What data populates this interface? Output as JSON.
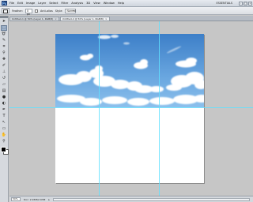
{
  "app": {
    "logo": "Ps",
    "menu": [
      "File",
      "Edit",
      "Image",
      "Layer",
      "Select",
      "Filter",
      "Analysis",
      "3D",
      "View",
      "Window",
      "Help"
    ],
    "workspace": "ESSENTIALS"
  },
  "options": {
    "feather_label": "Feather:",
    "feather_value": "0 px",
    "antialias_label": "Anti-alias",
    "style_label": "Style:",
    "style_value": "Normal"
  },
  "tabs": [
    {
      "label": "Untitled-1 @ 50% (Layer 1, RGB/8)"
    },
    {
      "label": "Untitled-2 @ 50% (Layer 1, RGB/8)"
    }
  ],
  "status": {
    "zoom": "50%",
    "doc_info": "Doc: 2.93M/2.93M"
  },
  "tools": [
    "move-icon",
    "marquee-icon",
    "lasso-icon",
    "quick-select-icon",
    "crop-icon",
    "eyedropper-icon",
    "healing-icon",
    "brush-icon",
    "stamp-icon",
    "history-brush-icon",
    "eraser-icon",
    "gradient-icon",
    "blur-icon",
    "dodge-icon",
    "pen-icon",
    "type-icon",
    "path-select-icon",
    "shape-icon",
    "hand-icon",
    "zoom-icon"
  ],
  "colors": {
    "guide": "#5fe0ff",
    "sky_top": "#3d7fc8",
    "sky_bottom": "#8cc0ec",
    "canvas_bg": "#c6c6c6"
  }
}
